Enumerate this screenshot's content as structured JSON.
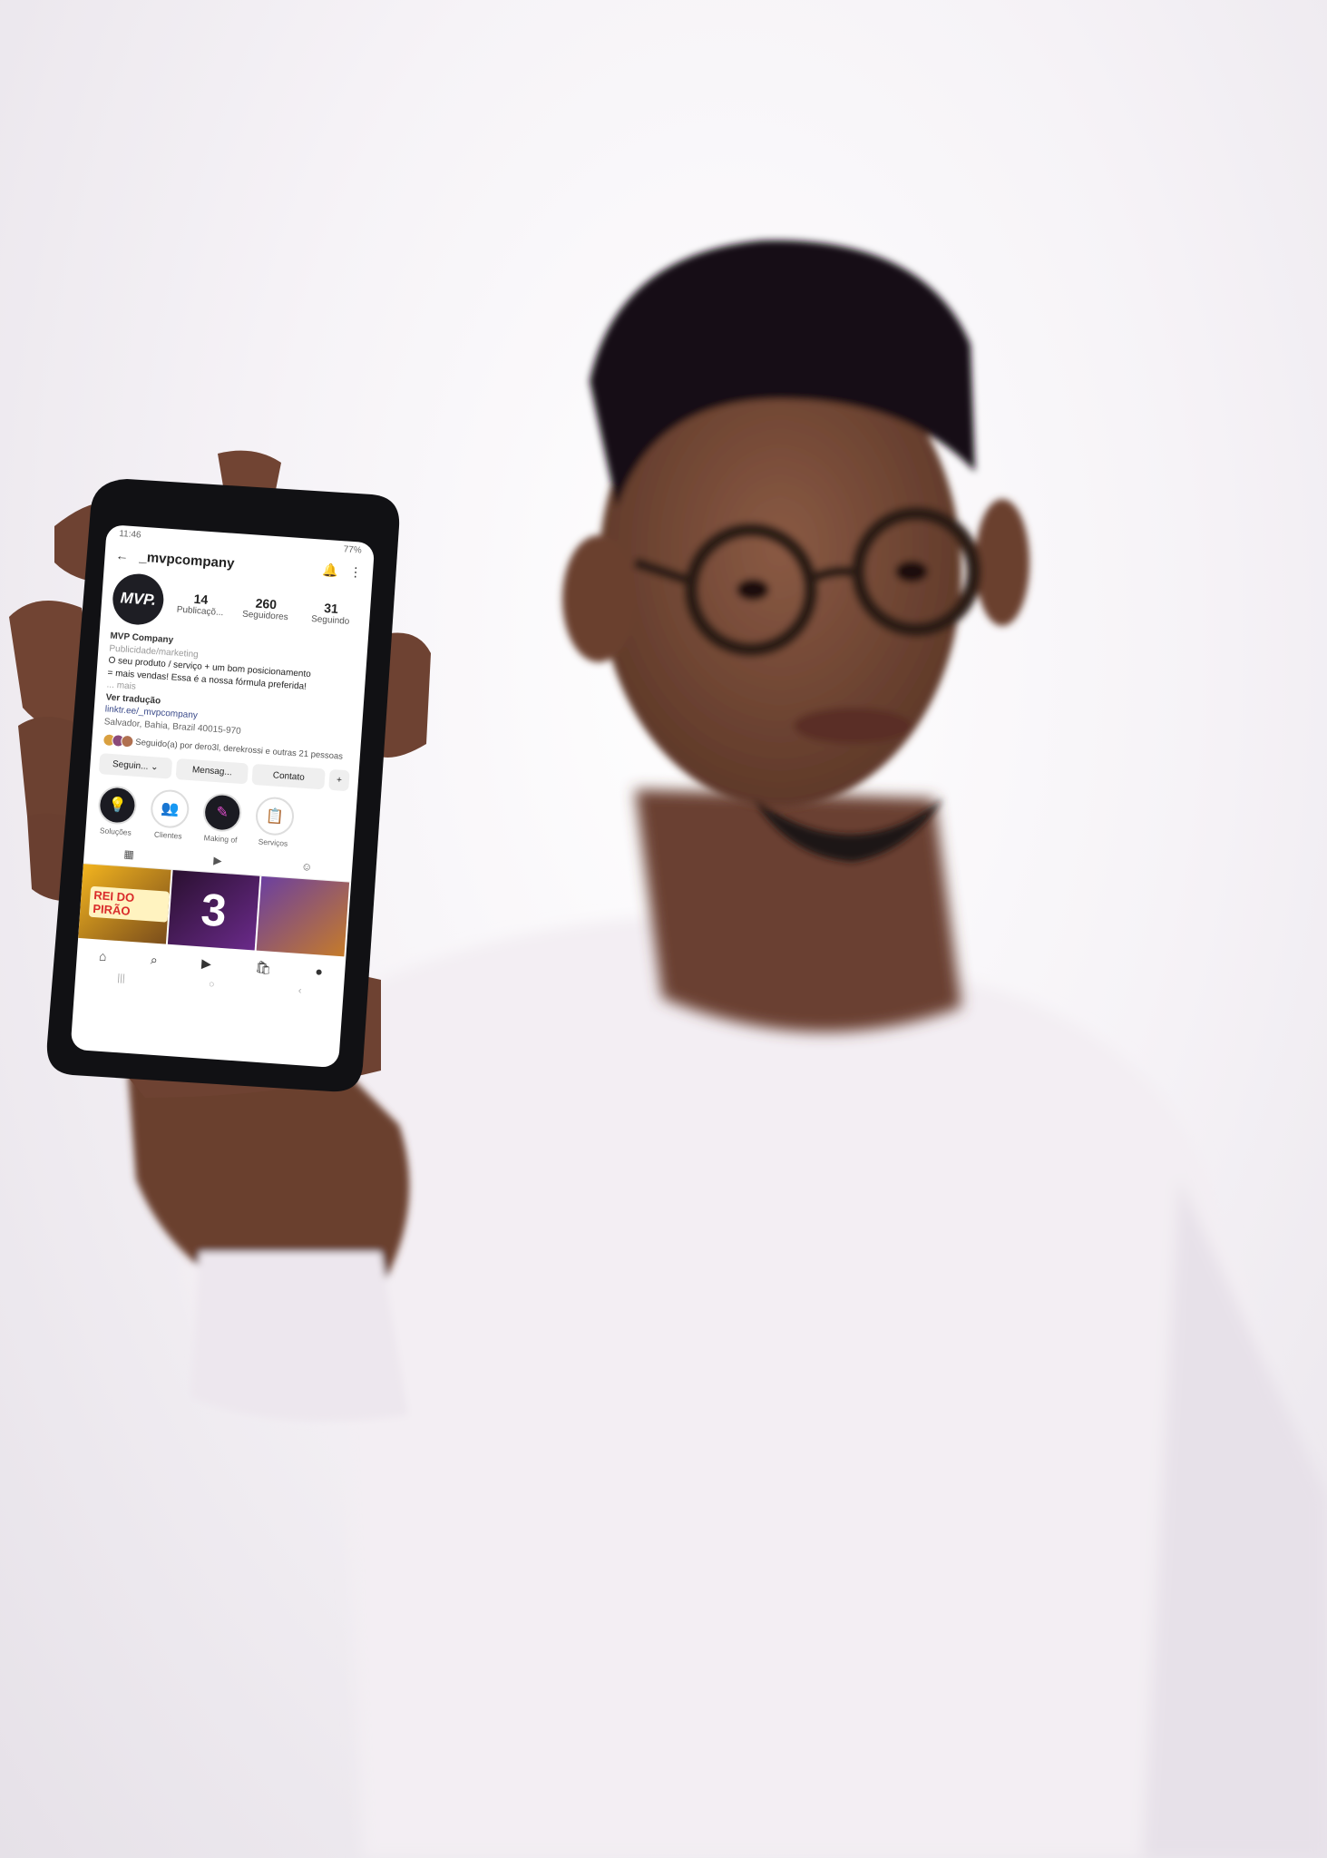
{
  "status": {
    "time": "11:46",
    "battery": "77%"
  },
  "profile": {
    "username": "_mvpcompany",
    "avatar_text": "MVP.",
    "stats": [
      {
        "number": "14",
        "label": "Publicaçõ..."
      },
      {
        "number": "260",
        "label": "Seguidores"
      },
      {
        "number": "31",
        "label": "Seguindo"
      }
    ],
    "name": "MVP Company",
    "category": "Publicidade/marketing",
    "bio_line1": "O seu produto / serviço + um bom posicionamento",
    "bio_line2": "= mais vendas! Essa é a nossa fórmula preferida!",
    "more": "... mais",
    "translate": "Ver tradução",
    "link": "linktr.ee/_mvpcompany",
    "location": "Salvador, Bahia, Brazil 40015-970",
    "followed_by": "Seguido(a) por dero3l, derekrossi e outras 21 pessoas"
  },
  "buttons": {
    "following": "Seguin... ⌄",
    "message": "Mensag...",
    "contact": "Contato",
    "add_person": "+"
  },
  "highlights": [
    {
      "label": "Soluções"
    },
    {
      "label": "Clientes"
    },
    {
      "label": "Making of"
    },
    {
      "label": "Serviços"
    }
  ],
  "grid_posts": [
    {
      "text": "REI DO PIRÃO"
    },
    {
      "text": "3"
    },
    {
      "text": ""
    }
  ],
  "colors": {
    "accent": "#e54fd1",
    "dark": "#1b1b22",
    "link": "#3a4a8a"
  }
}
